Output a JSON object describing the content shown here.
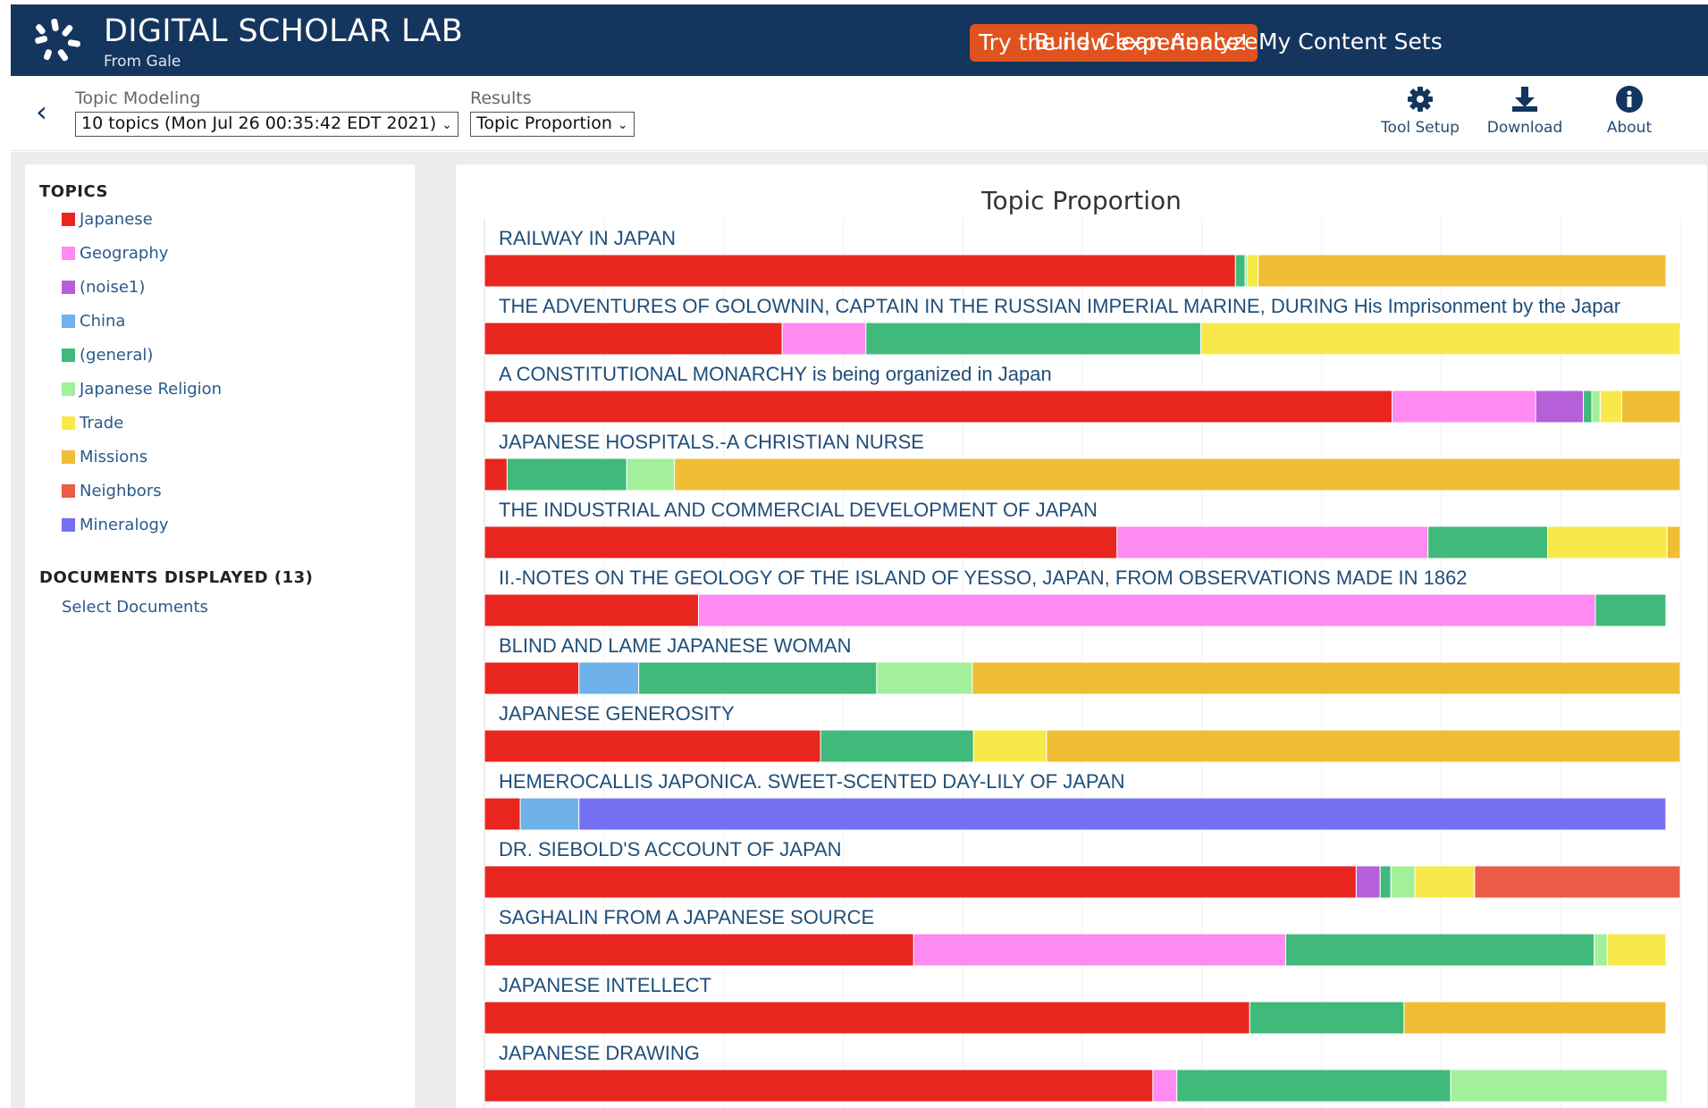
{
  "header": {
    "title": "DIGITAL SCHOLAR LAB",
    "subtitle": "From Gale",
    "try_label": "Try the new experience!",
    "nav": [
      "Build",
      "Clean",
      "Analyze",
      "My Content Sets"
    ]
  },
  "toolbar": {
    "tool_label": "Topic Modeling",
    "tool_value": "10 topics (Mon Jul 26 00:35:42 EDT 2021)",
    "results_label": "Results",
    "results_value": "Topic Proportion",
    "tool_setup": "Tool Setup",
    "download": "Download",
    "about": "About"
  },
  "sidebar": {
    "topics_heading": "TOPICS",
    "topics": [
      {
        "name": "Japanese",
        "color": "#e8261f"
      },
      {
        "name": "Geography",
        "color": "#ff8af0"
      },
      {
        "name": "(noise1)",
        "color": "#b65fdb"
      },
      {
        "name": "China",
        "color": "#6fb1ea"
      },
      {
        "name": "(general)",
        "color": "#3fba7a"
      },
      {
        "name": "Japanese Religion",
        "color": "#a3f09a"
      },
      {
        "name": "Trade",
        "color": "#f7e94a"
      },
      {
        "name": "Missions",
        "color": "#f0be35"
      },
      {
        "name": "Neighbors",
        "color": "#eb5b45"
      },
      {
        "name": "Mineralogy",
        "color": "#7570f2"
      }
    ],
    "documents_heading": "DOCUMENTS DISPLAYED (13)",
    "select_documents": "Select Documents"
  },
  "chart_data": {
    "type": "bar",
    "stacked": true,
    "orientation": "horizontal",
    "title": "Topic Proportion",
    "grid": true,
    "xlim": [
      0,
      1
    ],
    "series_names": [
      "Japanese",
      "Geography",
      "(noise1)",
      "China",
      "(general)",
      "Japanese Religion",
      "Trade",
      "Missions",
      "Neighbors",
      "Mineralogy"
    ],
    "colors": [
      "#e8261f",
      "#ff8af0",
      "#b65fdb",
      "#6fb1ea",
      "#3fba7a",
      "#a3f09a",
      "#f7e94a",
      "#f0be35",
      "#eb5b45",
      "#7570f2"
    ],
    "documents": [
      {
        "title": "RAILWAY IN JAPAN",
        "values": [
          0.628,
          0,
          0,
          0,
          0.008,
          0.002,
          0.009,
          0.341,
          0,
          0
        ]
      },
      {
        "title": "THE ADVENTURES OF GOLOWNIN, CAPTAIN IN THE RUSSIAN IMPERIAL MARINE, DURING His Imprisonment by the Japar",
        "values": [
          0.249,
          0.07,
          0,
          0,
          0.28,
          0,
          0.401,
          0,
          0,
          0
        ]
      },
      {
        "title": "A CONSTITUTIONAL MONARCHY is being organized in Japan",
        "values": [
          0.759,
          0.12,
          0.04,
          0,
          0.007,
          0.007,
          0.018,
          0.049,
          0,
          0
        ]
      },
      {
        "title": "JAPANESE HOSPITALS.-A CHRISTIAN NURSE",
        "values": [
          0.019,
          0,
          0,
          0,
          0.1,
          0.04,
          0,
          0.841,
          0,
          0
        ]
      },
      {
        "title": "THE INDUSTRIAL AND COMMERCIAL DEVELOPMENT OF JAPAN",
        "values": [
          0.529,
          0.26,
          0,
          0,
          0.1,
          0,
          0.1,
          0.011,
          0,
          0
        ]
      },
      {
        "title": "II.-NOTES ON THE GEOLOGY OF THE ISLAND OF YESSO, JAPAN, FROM OBSERVATIONS MADE IN 1862",
        "values": [
          0.179,
          0.75,
          0,
          0,
          0.059,
          0,
          0,
          0,
          0,
          0
        ]
      },
      {
        "title": "BLIND AND LAME JAPANESE WOMAN",
        "values": [
          0.079,
          0,
          0,
          0.05,
          0.199,
          0.08,
          0,
          0.592,
          0,
          0
        ]
      },
      {
        "title": "JAPANESE GENEROSITY",
        "values": [
          0.281,
          0,
          0,
          0,
          0.128,
          0,
          0.061,
          0.53,
          0,
          0
        ]
      },
      {
        "title": "HEMEROCALLIS JAPONICA. SWEET-SCENTED DAY-LILY OF JAPAN",
        "values": [
          0.03,
          0,
          0,
          0.049,
          0,
          0,
          0,
          0,
          0,
          0.909
        ]
      },
      {
        "title": "DR. SIEBOLD'S ACCOUNT OF JAPAN",
        "values": [
          0.729,
          0,
          0.02,
          0,
          0.009,
          0.02,
          0.05,
          0,
          0.172,
          0
        ]
      },
      {
        "title": "SAGHALIN FROM A JAPANESE SOURCE",
        "values": [
          0.359,
          0.311,
          0,
          0,
          0.258,
          0.011,
          0.049,
          0,
          0,
          0
        ]
      },
      {
        "title": "JAPANESE INTELLECT",
        "values": [
          0.64,
          0,
          0,
          0,
          0.129,
          0,
          0,
          0.219,
          0,
          0
        ]
      },
      {
        "title": "JAPANESE DRAWING",
        "values": [
          0.559,
          0.02,
          0,
          0,
          0.229,
          0.181,
          0,
          0,
          0,
          0
        ]
      }
    ]
  }
}
